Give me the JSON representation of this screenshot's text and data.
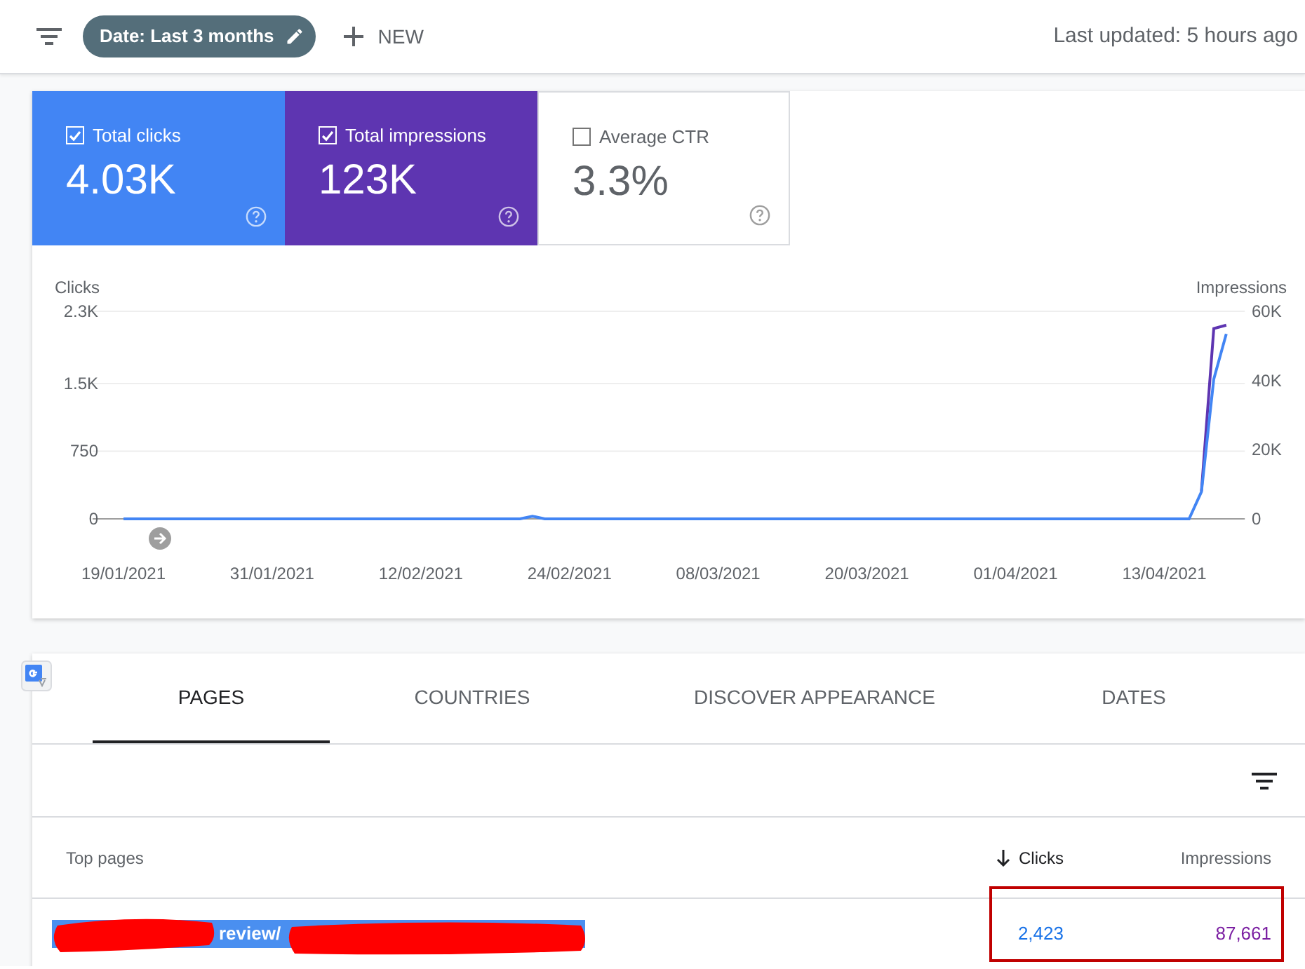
{
  "toolbar": {
    "date_filter": "Date: Last 3 months",
    "new_button": "NEW",
    "last_updated": "Last updated: 5 hours ago"
  },
  "metrics": [
    {
      "label": "Total clicks",
      "value": "4.03K",
      "checked": true,
      "color": "#4285f4"
    },
    {
      "label": "Total impressions",
      "value": "123K",
      "checked": true,
      "color": "#5e35b1"
    },
    {
      "label": "Average CTR",
      "value": "3.3%",
      "checked": false
    }
  ],
  "chart": {
    "chart_data": {
      "type": "line",
      "ylabel": "Clicks",
      "y2label": "Impressions",
      "categories": [
        "19/01/2021",
        null,
        null,
        null,
        null,
        null,
        null,
        null,
        null,
        null,
        null,
        null,
        "31/01/2021",
        null,
        null,
        null,
        null,
        null,
        null,
        null,
        null,
        null,
        null,
        null,
        "12/02/2021",
        null,
        null,
        null,
        null,
        null,
        null,
        null,
        null,
        null,
        null,
        null,
        "24/02/2021",
        null,
        null,
        null,
        null,
        null,
        null,
        null,
        null,
        null,
        null,
        null,
        "08/03/2021",
        null,
        null,
        null,
        null,
        null,
        null,
        null,
        null,
        null,
        null,
        null,
        "20/03/2021",
        null,
        null,
        null,
        null,
        null,
        null,
        null,
        null,
        null,
        null,
        null,
        "01/04/2021",
        null,
        null,
        null,
        null,
        null,
        null,
        null,
        null,
        null,
        null,
        null,
        "13/04/2021",
        null,
        null,
        null,
        null,
        null
      ],
      "ylim": [
        0,
        2300
      ],
      "yticks": [
        {
          "value": 0,
          "label": "0"
        },
        {
          "value": 750,
          "label": "750"
        },
        {
          "value": 1500,
          "label": "1.5K"
        },
        {
          "value": 2300,
          "label": "2.3K"
        }
      ],
      "y2lim": [
        0,
        60000
      ],
      "y2ticks": [
        {
          "value": 0,
          "label": "0"
        },
        {
          "value": 20000,
          "label": "20K"
        },
        {
          "value": 40000,
          "label": "40K"
        },
        {
          "value": 60000,
          "label": "60K"
        }
      ],
      "series": [
        {
          "color": "#5e35b1",
          "axis": "y2",
          "values": [
            null,
            null,
            null,
            null,
            null,
            null,
            null,
            null,
            null,
            null,
            null,
            null,
            null,
            null,
            null,
            null,
            null,
            null,
            null,
            null,
            null,
            null,
            null,
            null,
            null,
            null,
            null,
            null,
            null,
            null,
            null,
            null,
            null,
            null,
            null,
            null,
            null,
            null,
            null,
            null,
            null,
            null,
            null,
            null,
            null,
            null,
            null,
            null,
            null,
            null,
            null,
            null,
            null,
            null,
            null,
            null,
            null,
            null,
            null,
            null,
            null,
            null,
            null,
            null,
            null,
            null,
            null,
            null,
            null,
            null,
            null,
            null,
            null,
            null,
            null,
            null,
            null,
            null,
            null,
            null,
            null,
            null,
            null,
            null,
            null,
            null,
            null,
            8000,
            55000,
            56000
          ]
        },
        {
          "color": "#4285f4",
          "values": [
            0,
            0,
            0,
            0,
            0,
            0,
            0,
            0,
            0,
            0,
            0,
            0,
            0,
            0,
            0,
            0,
            0,
            0,
            0,
            0,
            0,
            0,
            0,
            0,
            0,
            0,
            0,
            0,
            0,
            0,
            0,
            0,
            0,
            30,
            0,
            0,
            0,
            0,
            0,
            0,
            0,
            0,
            0,
            0,
            0,
            0,
            0,
            0,
            0,
            0,
            0,
            0,
            0,
            0,
            0,
            0,
            0,
            0,
            0,
            0,
            0,
            0,
            0,
            0,
            0,
            0,
            0,
            0,
            0,
            0,
            0,
            0,
            0,
            0,
            0,
            0,
            0,
            0,
            0,
            0,
            0,
            0,
            0,
            0,
            0,
            0,
            0,
            300,
            1550,
            2050
          ]
        }
      ]
    }
  },
  "tabs": [
    {
      "label": "PAGES",
      "selected": true
    },
    {
      "label": "COUNTRIES",
      "selected": false
    },
    {
      "label": "DISCOVER APPEARANCE",
      "selected": false
    },
    {
      "label": "DATES",
      "selected": false
    }
  ],
  "table": {
    "columns": [
      {
        "label": "Top pages",
        "sorted": false
      },
      {
        "label": "Clicks",
        "sorted": true
      },
      {
        "label": "Impressions",
        "sorted": false
      }
    ],
    "rows": [
      {
        "page": "review/",
        "clicks": "2,423",
        "impressions": "87,661"
      }
    ]
  }
}
